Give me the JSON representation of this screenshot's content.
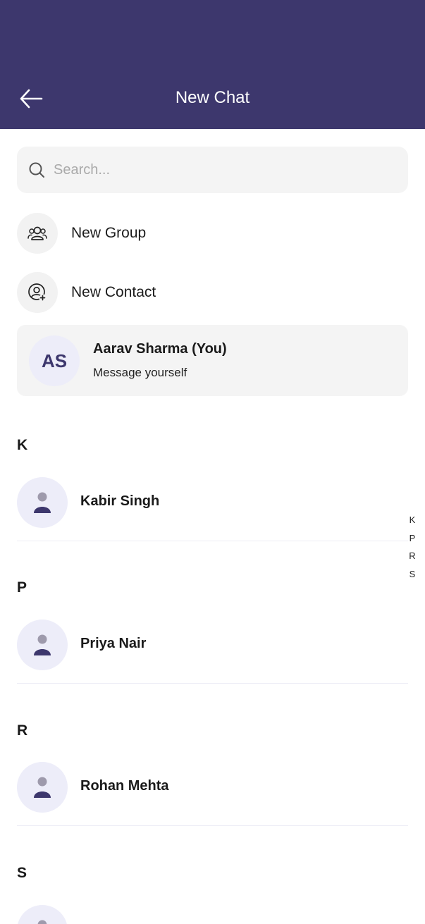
{
  "header": {
    "title": "New Chat"
  },
  "search": {
    "placeholder": "Search...",
    "value": ""
  },
  "actions": {
    "new_group": "New Group",
    "new_contact": "New Contact"
  },
  "self": {
    "initials": "AS",
    "name": "Aarav Sharma (You)",
    "subtitle": "Message yourself"
  },
  "sections": [
    {
      "letter": "K",
      "contact": "Kabir Singh"
    },
    {
      "letter": "P",
      "contact": "Priya Nair"
    },
    {
      "letter": "R",
      "contact": "Rohan Mehta"
    },
    {
      "letter": "S",
      "contact": ""
    }
  ],
  "alphabet_index": [
    "K",
    "P",
    "R",
    "S"
  ],
  "colors": {
    "header_bg": "#3d376d",
    "avatar_bg": "#ededf9",
    "avatar_fg": "#3d376d",
    "card_bg": "#f4f4f4"
  },
  "icons": {
    "back": "arrow-left-icon",
    "search": "search-icon",
    "group": "group-icon",
    "add_contact": "add-contact-icon",
    "person": "person-icon"
  }
}
